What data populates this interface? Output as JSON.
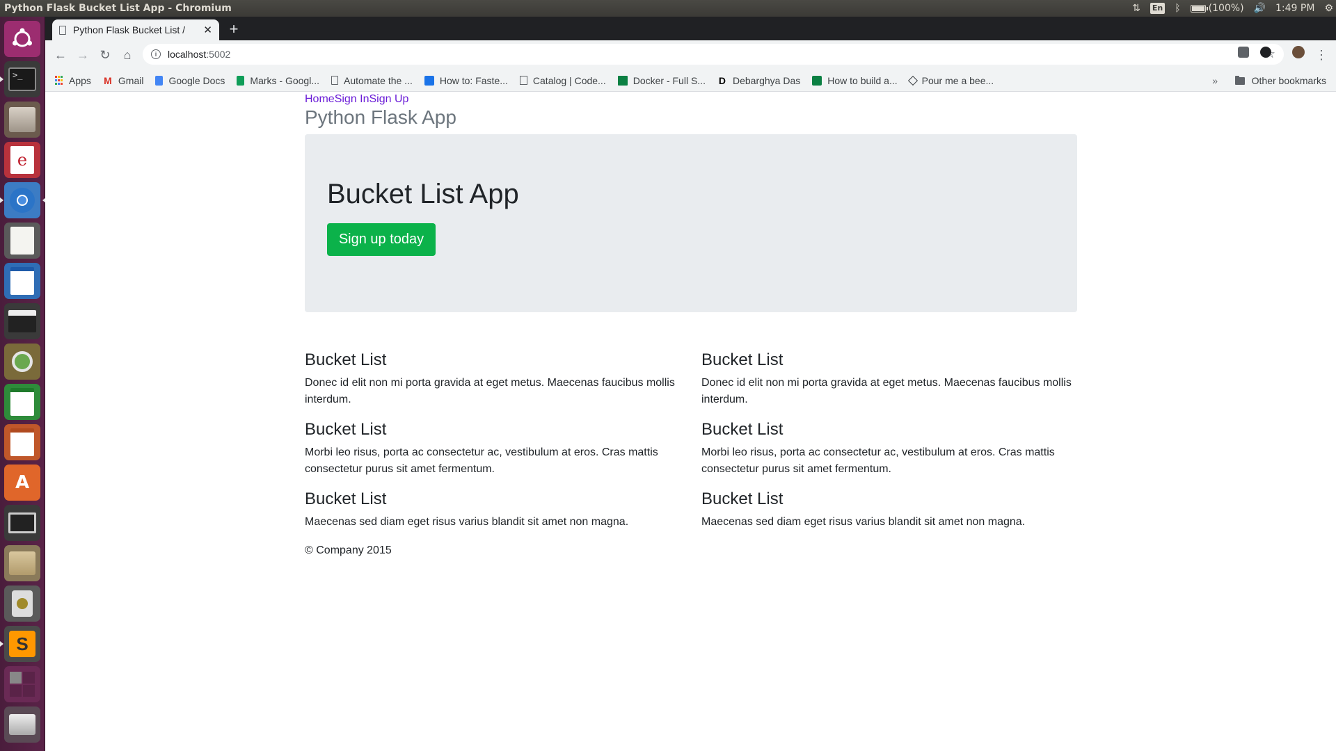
{
  "top_panel": {
    "window_title": "Python Flask Bucket List App - Chromium",
    "keyboard_layout": "En",
    "battery": "(100%)",
    "clock": "1:49 PM",
    "icons": [
      "network-icon",
      "keyboard-layout-icon",
      "bluetooth-icon",
      "battery-icon",
      "volume-icon",
      "session-gear-icon"
    ]
  },
  "launcher": {
    "items": [
      "dash-home",
      "terminal",
      "file-cabinet",
      "evince",
      "chromium",
      "text-editor",
      "writer",
      "video-editor",
      "image-viewer",
      "calc",
      "impress",
      "software-center",
      "lock-screen",
      "archive-manager",
      "disk-utility",
      "sublime-text",
      "workspace-switcher",
      "trash"
    ]
  },
  "browser": {
    "tab": {
      "title": "Python Flask Bucket List App - Chromium",
      "short_title": "Python Flask Bucket List /"
    },
    "address": {
      "host": "localhost",
      "port": ":5002"
    },
    "bookmarks": [
      {
        "label": "Apps",
        "icon": "apps-grid-icon",
        "color": "#4285f4"
      },
      {
        "label": "Gmail",
        "icon": "gmail-icon",
        "color": "#d93025"
      },
      {
        "label": "Google Docs",
        "icon": "docs-icon",
        "color": "#4285f4"
      },
      {
        "label": "Marks - Googl...",
        "icon": "sheets-icon",
        "color": "#0f9d58"
      },
      {
        "label": "Automate the ...",
        "icon": "page-icon",
        "color": "#5f6368"
      },
      {
        "label": "How to: Faste...",
        "icon": "howto-icon",
        "color": "#1a73e8"
      },
      {
        "label": "Catalog | Code...",
        "icon": "catalog-icon",
        "color": "#5f6368"
      },
      {
        "label": "Docker - Full S...",
        "icon": "docker-icon",
        "color": "#0b8043"
      },
      {
        "label": "Debarghya Das",
        "icon": "d-icon",
        "color": "#000000"
      },
      {
        "label": "How to build a...",
        "icon": "build-icon",
        "color": "#0b8043"
      },
      {
        "label": "Pour me a bee...",
        "icon": "codepen-icon",
        "color": "#3c4043"
      }
    ],
    "bookmarks_overflow": "»",
    "other_bookmarks": "Other bookmarks"
  },
  "page": {
    "nav": {
      "home": "Home",
      "sign_in": "Sign In",
      "sign_up": "Sign Up"
    },
    "brand": "Python Flask App",
    "jumbotron": {
      "title": "Bucket List App",
      "button": "Sign up today"
    },
    "columns": [
      [
        {
          "title": "Bucket List",
          "text": "Donec id elit non mi porta gravida at eget metus. Maecenas faucibus mollis interdum."
        },
        {
          "title": "Bucket List",
          "text": "Morbi leo risus, porta ac consectetur ac, vestibulum at eros. Cras mattis consectetur purus sit amet fermentum."
        },
        {
          "title": "Bucket List",
          "text": "Maecenas sed diam eget risus varius blandit sit amet non magna."
        }
      ],
      [
        {
          "title": "Bucket List",
          "text": "Donec id elit non mi porta gravida at eget metus. Maecenas faucibus mollis interdum."
        },
        {
          "title": "Bucket List",
          "text": "Morbi leo risus, porta ac consectetur ac, vestibulum at eros. Cras mattis consectetur purus sit amet fermentum."
        },
        {
          "title": "Bucket List",
          "text": "Maecenas sed diam eget risus varius blandit sit amet non magna."
        }
      ]
    ],
    "footer": "© Company 2015"
  },
  "colors": {
    "accent_button": "#0bb24a",
    "link": "#6a1bd7",
    "jumbotron_bg": "#e9ecef",
    "launcher_bg": "#4a1d3c"
  }
}
